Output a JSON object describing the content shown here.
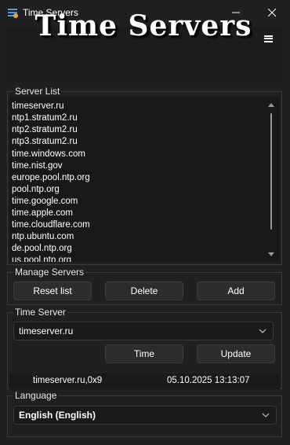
{
  "window": {
    "title": "Time Servers",
    "minimize_glyph": "—",
    "close_glyph": "✕"
  },
  "banner": {
    "title": "Time Servers",
    "menu_icon": "hamburger-menu-icon"
  },
  "server_list": {
    "legend": "Server List",
    "items": [
      "timeserver.ru",
      "ntp1.stratum2.ru",
      "ntp2.stratum2.ru",
      "ntp3.stratum2.ru",
      "time.windows.com",
      "time.nist.gov",
      "europe.pool.ntp.org",
      "pool.ntp.org",
      "time.google.com",
      "time.apple.com",
      "time.cloudflare.com",
      "ntp.ubuntu.com",
      "de.pool.ntp.org",
      "us.pool.ntp.org"
    ]
  },
  "manage_servers": {
    "legend": "Manage Servers",
    "reset_label": "Reset list",
    "delete_label": "Delete",
    "add_label": "Add"
  },
  "time_server": {
    "legend": "Time Server",
    "selected": "timeserver.ru",
    "time_label": "Time",
    "update_label": "Update",
    "status_server": "timeserver.ru,0x9",
    "status_datetime": "05.10.2025 13:13:07"
  },
  "language": {
    "legend": "Language",
    "selected": "English (English)"
  },
  "colors": {
    "background": "#202020",
    "panel": "#1a1a1a",
    "button": "#2d2d2d",
    "border": "#3a3a3a",
    "text": "#ffffff"
  }
}
